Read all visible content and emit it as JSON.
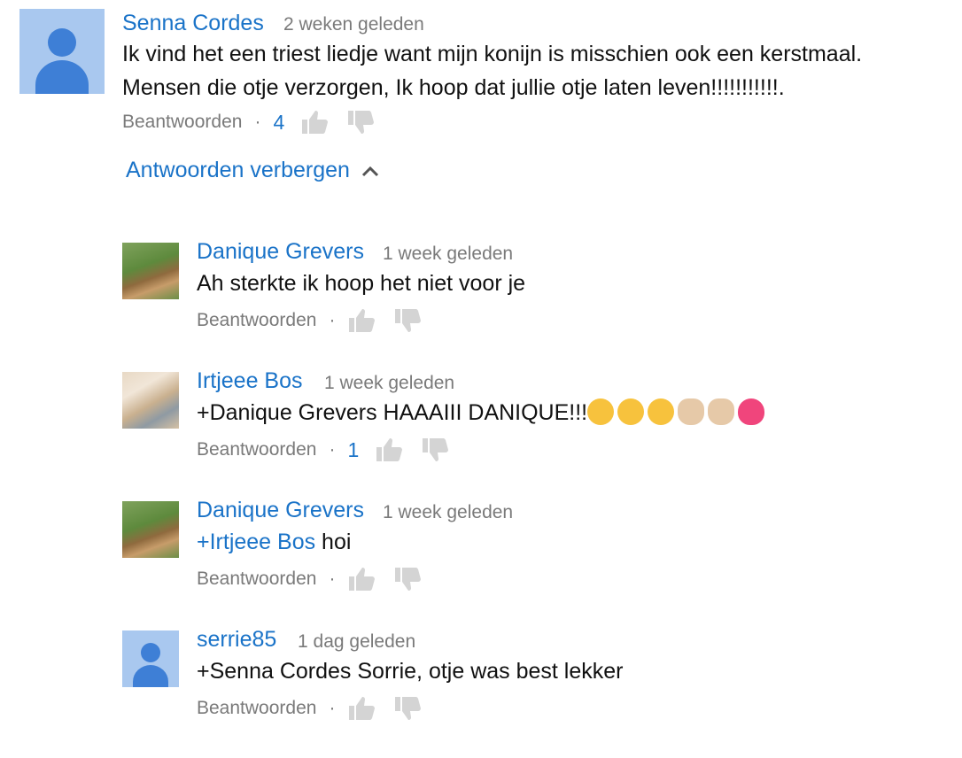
{
  "comments": [
    {
      "author": "Senna Cordes",
      "time": "2 weken geleden",
      "lines": [
        "Ik vind het een triest liedje want mijn konijn is misschien ook een kerstmaal.",
        "Mensen die otje verzorgen, Ik hoop dat jullie otje laten leven!!!!!!!!!!!."
      ],
      "reply_label": "Beantwoorden",
      "likes": "4"
    }
  ],
  "toggle": {
    "label": "Antwoorden verbergen"
  },
  "replies": [
    {
      "author": "Danique Grevers",
      "time": "1 week geleden",
      "text": "Ah sterkte ik hoop het niet voor je",
      "reply_label": "Beantwoorden"
    },
    {
      "author": "Irtjeee Bos",
      "time": "1 week geleden",
      "text": "+Danique Grevers HAAAIII DANIQUE!!!",
      "emoji": [
        "smiling-face-sunglasses",
        "smirking-face",
        "tears-of-joy",
        "waving-hand",
        "waving-hand",
        "sparkling-heart"
      ],
      "reply_label": "Beantwoorden",
      "likes": "1"
    },
    {
      "author": "Danique Grevers",
      "time": "1 week geleden",
      "mention": "+Irtjeee Bos",
      "text": " hoi",
      "reply_label": "Beantwoorden"
    },
    {
      "author": "serrie85",
      "time": "1 dag geleden",
      "text": "+Senna Cordes Sorrie, otje was best lekker",
      "reply_label": "Beantwoorden"
    }
  ],
  "colors": {
    "link": "#1a73c8",
    "muted": "#7a7a7a",
    "avatar_bg": "#a9c8ef",
    "avatar_fg": "#3e7fd6"
  },
  "icons": {
    "like": "thumbs-up-icon",
    "dislike": "thumbs-down-icon",
    "toggle": "chevron-up-icon"
  }
}
